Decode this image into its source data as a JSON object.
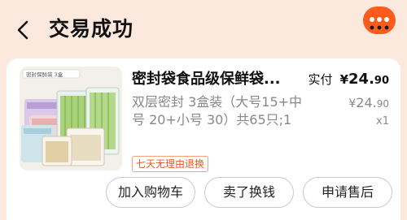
{
  "header": {
    "title": "交易成功"
  },
  "order": {
    "product_title": "密封袋食品级保鲜袋...",
    "paid_label": "实付",
    "paid_price": {
      "symbol": "¥",
      "integer": "24.",
      "decimal": "90"
    },
    "spec": "双层密封 3盒装（大号15+中号 20+小号 30）共65只;1",
    "original_price": {
      "symbol": "¥",
      "integer": "24.",
      "decimal": "90"
    },
    "quantity": "x1",
    "return_badge": "七天无理由退换",
    "thumbnail_label": "密封保鲜袋 3盒"
  },
  "actions": {
    "add_to_cart": "加入购物车",
    "resell": "卖了换钱",
    "after_sale": "申请售后"
  },
  "colors": {
    "page_bg": "#fbe9de",
    "accent_orange": "#fb5b1c",
    "badge_orange": "#e65a23",
    "muted_text": "#888888"
  },
  "icons": {
    "back": "chevron-left-icon",
    "more": "more-dots-icon"
  }
}
